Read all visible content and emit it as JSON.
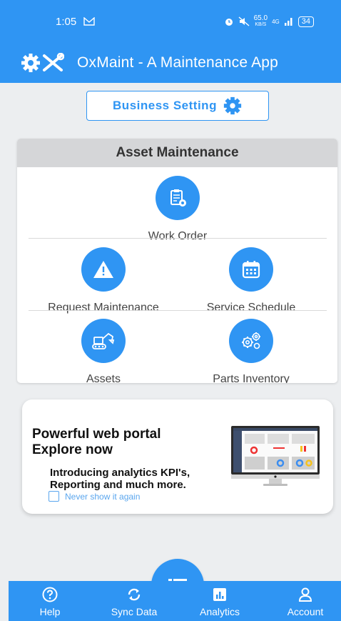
{
  "status_bar": {
    "time": "1:05",
    "speed": "65.0",
    "speed_unit": "KB/S",
    "network": "4G",
    "battery": "34"
  },
  "app_bar": {
    "title": "OxMaint - A Maintenance App"
  },
  "business_setting": {
    "label": "Business Setting"
  },
  "asset_card": {
    "title": "Asset Maintenance",
    "tiles": [
      {
        "label": "Work Order",
        "icon": "clipboard-gear-icon"
      },
      {
        "label": "Request Maintenance",
        "icon": "warning-icon"
      },
      {
        "label": "Service Schedule",
        "icon": "calendar-icon"
      },
      {
        "label": "Assets",
        "icon": "excavator-icon"
      },
      {
        "label": "Parts Inventory",
        "icon": "gears-icon"
      }
    ]
  },
  "promo": {
    "heading_line1": "Powerful web portal",
    "heading_line2": "Explore now",
    "sub_line1": "Introducing analytics KPI's,",
    "sub_line2": "Reporting and much more.",
    "never_show": "Never show it again"
  },
  "bottom_nav": {
    "items": [
      {
        "label": "Help",
        "icon": "help-icon"
      },
      {
        "label": "Sync Data",
        "icon": "sync-icon"
      },
      {
        "label": "Analytics",
        "icon": "analytics-icon"
      },
      {
        "label": "Account",
        "icon": "account-icon"
      }
    ],
    "fab_icon": "list-icon"
  },
  "colors": {
    "primary": "#2f95f3",
    "background": "#eceef0",
    "card_header": "#d5d6d8"
  }
}
